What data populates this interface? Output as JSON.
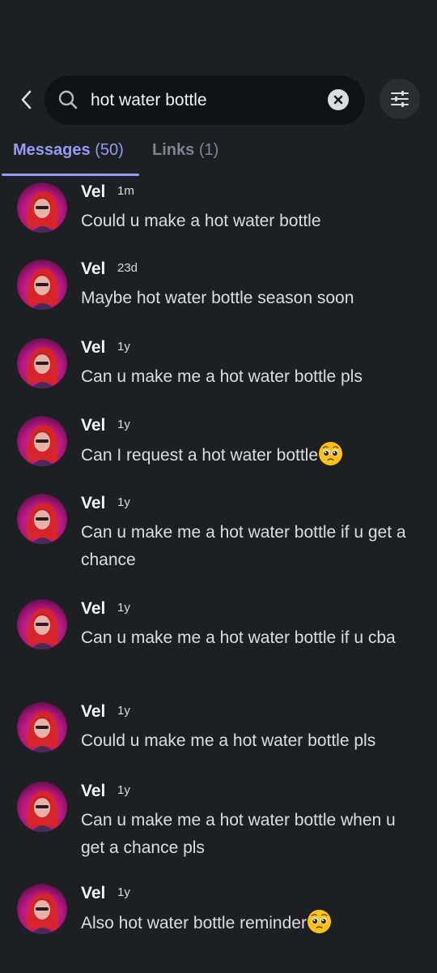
{
  "search": {
    "query": "hot water bottle",
    "back_icon": "chevron-left-icon",
    "search_icon": "search-icon",
    "clear_icon": "close-circle-icon",
    "filter_icon": "sliders-icon"
  },
  "tabs": [
    {
      "label": "Messages",
      "count": "(50)",
      "active": true
    },
    {
      "label": "Links",
      "count": "(1)",
      "active": false
    }
  ],
  "colors": {
    "background": "#1e1f22",
    "accent": "#949cf7",
    "search_bg": "#111214"
  },
  "messages": [
    {
      "author": "Vel",
      "time": "1m",
      "text": "Could u make a hot water bottle",
      "emoji": ""
    },
    {
      "author": "Vel",
      "time": "23d",
      "text": "Maybe hot water bottle season soon",
      "emoji": ""
    },
    {
      "author": "Vel",
      "time": "1y",
      "text": "Can u make me a hot water bottle pls",
      "emoji": ""
    },
    {
      "author": "Vel",
      "time": "1y",
      "text": "Can I request a hot water bottle",
      "emoji": "pleading-face"
    },
    {
      "author": "Vel",
      "time": "1y",
      "text": "Can u make me a hot water bottle if u get a chance",
      "emoji": ""
    },
    {
      "author": "Vel",
      "time": "1y",
      "text": "Can u make me a hot water bottle if u cba",
      "emoji": ""
    },
    {
      "author": "Vel",
      "time": "1y",
      "text": "Could u make me a hot water bottle pls",
      "emoji": ""
    },
    {
      "author": "Vel",
      "time": "1y",
      "text": "Can u make me a hot water bottle when u get a chance pls",
      "emoji": ""
    },
    {
      "author": "Vel",
      "time": "1y",
      "text": "Also hot water bottle reminder",
      "emoji": "pleading-face"
    }
  ]
}
